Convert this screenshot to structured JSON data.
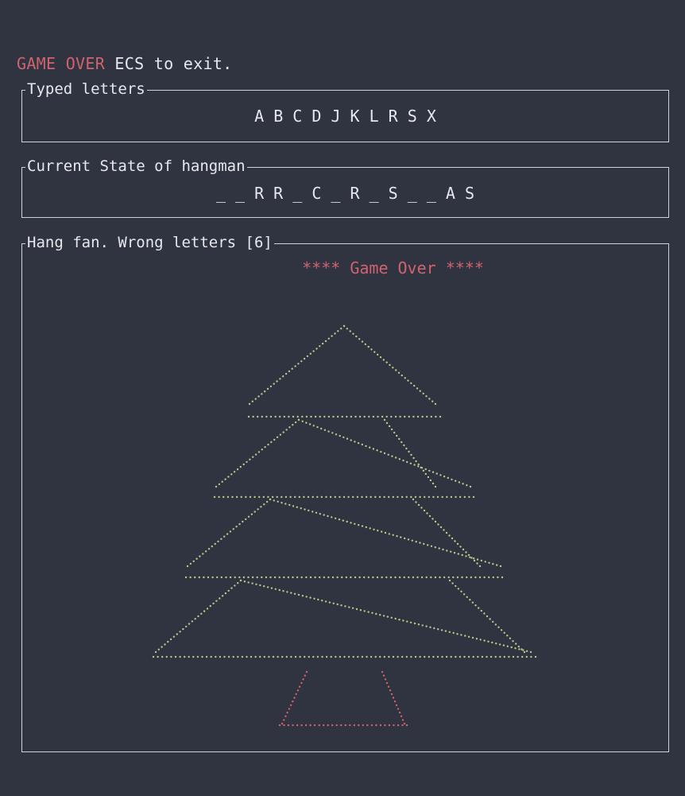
{
  "status": {
    "game_over_label": "GAME OVER",
    "exit_hint": " ECS to exit."
  },
  "typed_panel": {
    "title": "Typed letters",
    "letters": "A B C D J K L R S X"
  },
  "state_panel": {
    "title": "Current State of hangman",
    "word_state": "_ _ R R _ C _ R _ S _ _ A S"
  },
  "hang_panel": {
    "title": "Hang fan. Wrong letters [6]",
    "game_over_banner": "**** Game Over ****"
  },
  "colors": {
    "background": "#2f3440",
    "tree": "#b5c98a",
    "trunk": "#d0636e",
    "alert": "#d0636e",
    "text": "#e6e8ee"
  }
}
